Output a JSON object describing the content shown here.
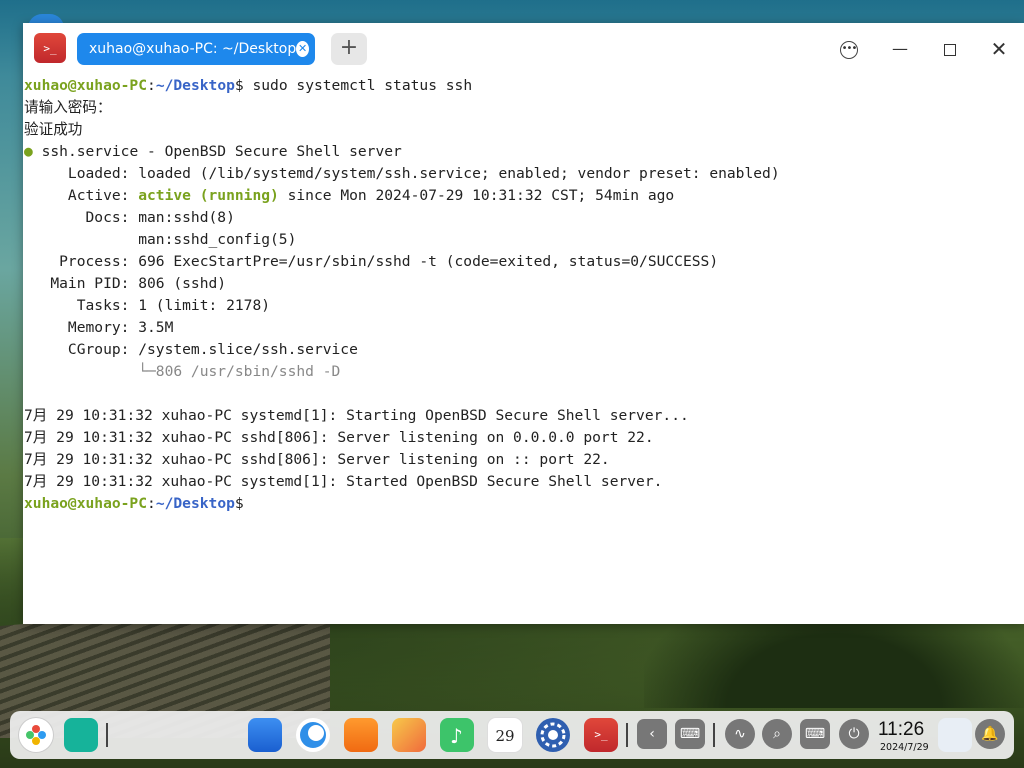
{
  "window": {
    "tab_title": "xuhao@xuhao-PC: ~/Desktop",
    "new_tab_label": "+",
    "app_icon_label": ">_"
  },
  "terminal": {
    "prompt_user": "xuhao@xuhao-PC",
    "prompt_sep": ":",
    "prompt_path": "~/Desktop",
    "prompt_sign": "$",
    "command": " sudo systemctl status ssh",
    "lines": [
      "请输入密码：",
      "验证成功"
    ],
    "service_dot": "●",
    "service_line": " ssh.service - OpenBSD Secure Shell server",
    "loaded_line": "     Loaded: loaded (/lib/systemd/system/ssh.service; enabled; vendor preset: enabled)",
    "active_label": "     Active: ",
    "active_status": "active (running)",
    "active_rest": " since Mon 2024-07-29 10:31:32 CST; 54min ago",
    "docs_line": "       Docs: man:sshd(8)",
    "docs_line2": "             man:sshd_config(5)",
    "process_line": "    Process: 696 ExecStartPre=/usr/sbin/sshd -t (code=exited, status=0/SUCCESS)",
    "mainpid_line": "   Main PID: 806 (sshd)",
    "tasks_line": "      Tasks: 1 (limit: 2178)",
    "memory_line": "     Memory: 3.5M",
    "cgroup_line": "     CGroup: /system.slice/ssh.service",
    "cgroup_child": "             └─806 /usr/sbin/sshd -D",
    "log_lines": [
      "7月 29 10:31:32 xuhao-PC systemd[1]: Starting OpenBSD Secure Shell server...",
      "7月 29 10:31:32 xuhao-PC sshd[806]: Server listening on 0.0.0.0 port 22.",
      "7月 29 10:31:32 xuhao-PC sshd[806]: Server listening on :: port 22.",
      "7月 29 10:31:32 xuhao-PC systemd[1]: Started OpenBSD Secure Shell server."
    ]
  },
  "dock": {
    "clock_time": "11:26",
    "clock_date": "2024/7/29",
    "calendar_day": "29"
  }
}
